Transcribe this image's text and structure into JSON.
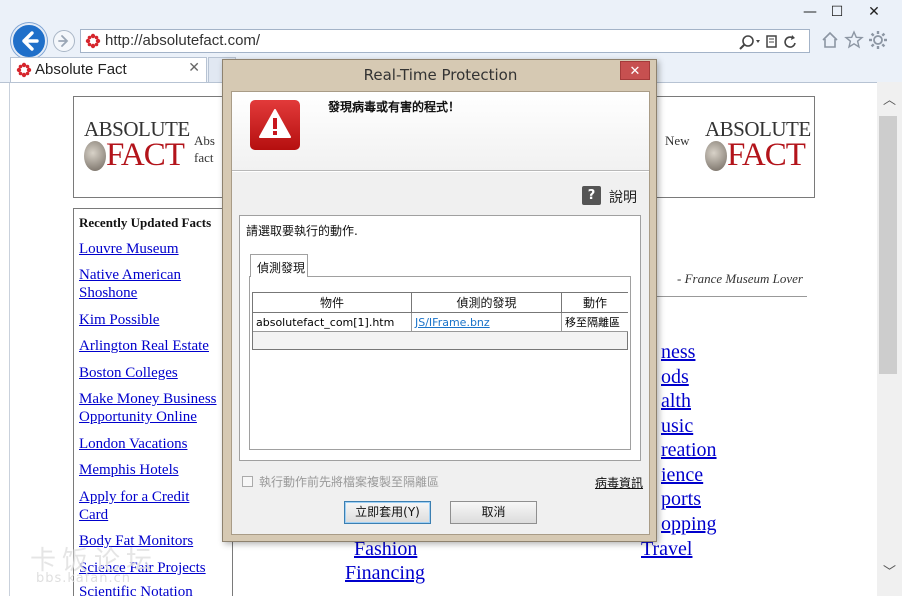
{
  "browser": {
    "url": "http://absolutefact.com/",
    "tab_title": "Absolute Fact",
    "tab_close": "✕",
    "window_minimize": "—",
    "window_maximize": "☐",
    "window_close": "✕",
    "accent_color": "#1f6fc9"
  },
  "site": {
    "logo_top": "ABSOLUTE",
    "logo_bottom": "FACT",
    "header_snippet_left_1": "Abs",
    "header_snippet_left_2": "fact",
    "header_snippet_right": "New",
    "sidebar_title": "Recently Updated Facts",
    "sidebar_links": [
      "Louvre Museum",
      "Native American",
      "Shoshone",
      "Kim Possible",
      "Arlington Real Estate",
      "Boston Colleges",
      "Make Money Business",
      "Opportunity Online",
      "London Vacations",
      "Memphis Hotels",
      "Apply for a Credit",
      "Card",
      "Body Fat Monitors",
      "Science Fair Projects",
      "Scientific Notation"
    ],
    "quote": "- France Museum Lover",
    "categories_right": [
      "ness",
      "ods",
      "alth",
      "usic",
      "reation",
      "ience",
      "ports",
      "opping",
      "Travel"
    ],
    "categories_left": [
      "Fashion",
      "Financing"
    ]
  },
  "watermark": {
    "line1": "卡饭论坛",
    "line2": "bbs.kafan.cn"
  },
  "dialog": {
    "title": "Real-Time Protection",
    "close": "✕",
    "warning_message": "發現病毒或有害的程式！",
    "help_label": "說明",
    "help_icon": "?",
    "prompt": "請選取要執行的動作.",
    "tab_label": "偵測發現",
    "table": {
      "columns": [
        "物件",
        "偵測的發現",
        "動作"
      ],
      "rows": [
        {
          "object": "absolutefact_com[1].htm",
          "detection": "JS/IFrame.bnz",
          "action": "移至隔離區"
        }
      ]
    },
    "checkbox_label": "執行動作前先將檔案複製至隔離區",
    "virus_info_link": "病毒資訊",
    "apply_button": "立即套用(Y)",
    "cancel_button": "取消",
    "warning_color": "#c8161d"
  }
}
